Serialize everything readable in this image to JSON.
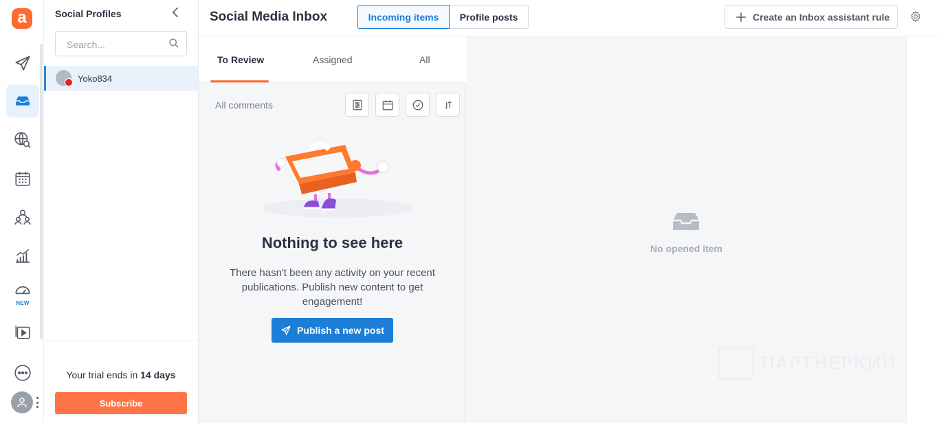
{
  "rail": {
    "logo_letter": "a",
    "new_badge": "NEW"
  },
  "profiles": {
    "title": "Social Profiles",
    "search_placeholder": "Search...",
    "items": [
      {
        "name": "Yoko834",
        "network": "youtube"
      }
    ],
    "trial_prefix": "Your trial ends in ",
    "trial_days": "14 days",
    "subscribe_label": "Subscribe"
  },
  "header": {
    "title": "Social Media Inbox",
    "tabs": [
      {
        "label": "Incoming items",
        "active": true
      },
      {
        "label": "Profile posts",
        "active": false
      }
    ],
    "rule_button_label": "Create an Inbox assistant rule"
  },
  "list": {
    "tabs": [
      {
        "label": "To Review",
        "active": true
      },
      {
        "label": "Assigned",
        "active": false
      },
      {
        "label": "All",
        "active": false
      }
    ],
    "filter_label": "All comments",
    "empty_title": "Nothing to see here",
    "empty_text": "There hasn't been any activity on your recent publications. Publish new content to get engagement!",
    "publish_label": "Publish a new post"
  },
  "detail": {
    "empty_label": "No opened item"
  },
  "watermark": {
    "text": "ПАРТНЕРКИН"
  },
  "colors": {
    "brand_orange": "#ff6a30",
    "accent_blue": "#1c7ed6",
    "youtube_red": "#e02424"
  }
}
